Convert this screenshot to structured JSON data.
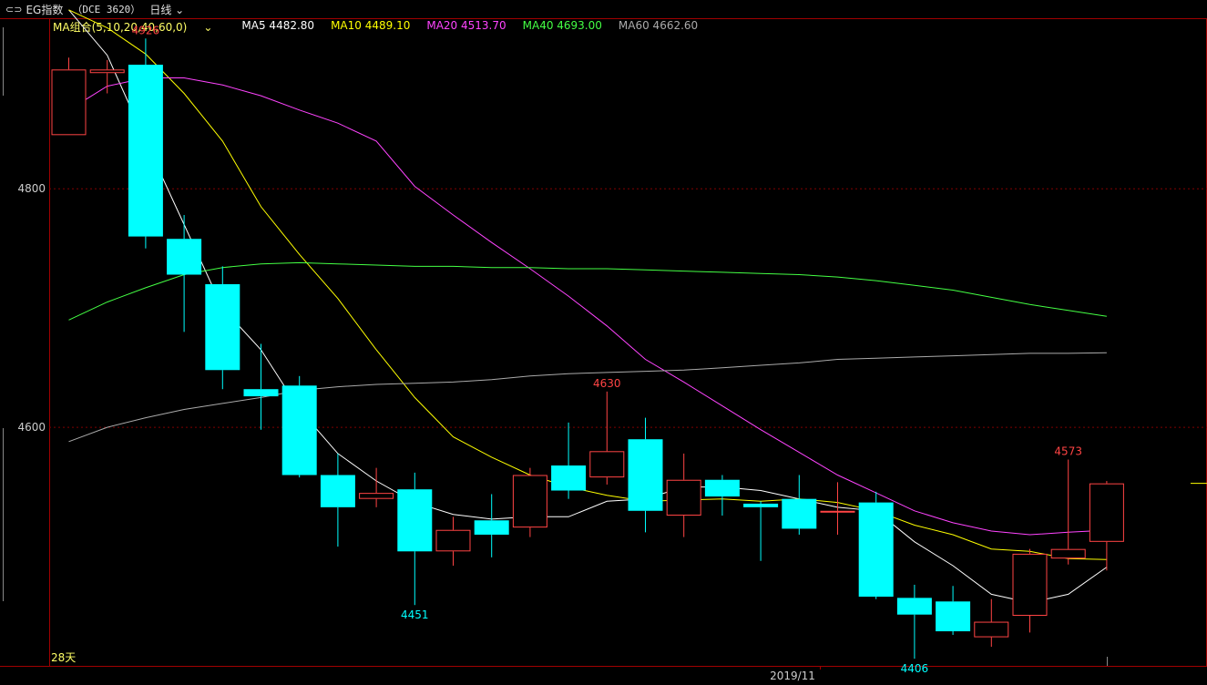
{
  "header": {
    "symbol": "EG指数",
    "code": "（DCE 3620）",
    "period": "日线",
    "period_arrow_icon": "chevron-down-icon"
  },
  "legend": {
    "group_label": "MA组合(5,10,20,40,60,0)",
    "items": [
      {
        "label": "MA5 4482.80",
        "color": "#ffffff"
      },
      {
        "label": "MA10 4489.10",
        "color": "#ffff00"
      },
      {
        "label": "MA20 4513.70",
        "color": "#ff44ff"
      },
      {
        "label": "MA40 4693.00",
        "color": "#44ff44"
      },
      {
        "label": "MA60 4662.60",
        "color": "#aaaaaa"
      }
    ]
  },
  "chart_data": {
    "type": "candlestick",
    "y_ticks": [
      4600,
      4800
    ],
    "ylim": [
      4400,
      4943
    ],
    "x_label": "2019/11",
    "days_label": "28天",
    "colors": {
      "up": "#ff4444",
      "down": "#00ffff",
      "grid": "#800000",
      "axis": "#a00000"
    },
    "candles": [
      {
        "o": 4845,
        "h": 4910,
        "l": 4845,
        "c": 4900
      },
      {
        "o": 4897,
        "h": 4908,
        "l": 4880,
        "c": 4900
      },
      {
        "o": 4904,
        "h": 4926,
        "l": 4750,
        "c": 4760
      },
      {
        "o": 4758,
        "h": 4778,
        "l": 4680,
        "c": 4728
      },
      {
        "o": 4720,
        "h": 4735,
        "l": 4632,
        "c": 4648
      },
      {
        "o": 4632,
        "h": 4670,
        "l": 4598,
        "c": 4626
      },
      {
        "o": 4635,
        "h": 4643,
        "l": 4558,
        "c": 4560
      },
      {
        "o": 4560,
        "h": 4578,
        "l": 4500,
        "c": 4533
      },
      {
        "o": 4540,
        "h": 4566,
        "l": 4533,
        "c": 4545
      },
      {
        "o": 4548,
        "h": 4562,
        "l": 4451,
        "c": 4496
      },
      {
        "o": 4496,
        "h": 4525,
        "l": 4484,
        "c": 4514
      },
      {
        "o": 4522,
        "h": 4544,
        "l": 4491,
        "c": 4510
      },
      {
        "o": 4516,
        "h": 4566,
        "l": 4508,
        "c": 4560
      },
      {
        "o": 4568,
        "h": 4604,
        "l": 4540,
        "c": 4547
      },
      {
        "o": 4558,
        "h": 4630,
        "l": 4552,
        "c": 4580
      },
      {
        "o": 4590,
        "h": 4608,
        "l": 4512,
        "c": 4530
      },
      {
        "o": 4526,
        "h": 4578,
        "l": 4508,
        "c": 4556
      },
      {
        "o": 4556,
        "h": 4560,
        "l": 4526,
        "c": 4542
      },
      {
        "o": 4536,
        "h": 4538,
        "l": 4488,
        "c": 4533
      },
      {
        "o": 4540,
        "h": 4560,
        "l": 4510,
        "c": 4515
      },
      {
        "o": 4530,
        "h": 4554,
        "l": 4510,
        "c": 4530
      },
      {
        "o": 4537,
        "h": 4546,
        "l": 4456,
        "c": 4458
      },
      {
        "o": 4457,
        "h": 4468,
        "l": 4406,
        "c": 4443
      },
      {
        "o": 4454,
        "h": 4467,
        "l": 4426,
        "c": 4429
      },
      {
        "o": 4424,
        "h": 4456,
        "l": 4416,
        "c": 4437
      },
      {
        "o": 4442,
        "h": 4498,
        "l": 4428,
        "c": 4494
      },
      {
        "o": 4490,
        "h": 4573,
        "l": 4485,
        "c": 4498
      },
      {
        "o": 4504,
        "h": 4555,
        "l": 4480,
        "c": 4553
      }
    ],
    "labels": [
      {
        "candle": 2,
        "value": 4926,
        "pos": "above",
        "text": "4926"
      },
      {
        "candle": 9,
        "value": 4451,
        "pos": "below",
        "text": "4451"
      },
      {
        "candle": 14,
        "value": 4630,
        "pos": "above",
        "text": "4630"
      },
      {
        "candle": 22,
        "value": 4406,
        "pos": "below",
        "text": "4406"
      },
      {
        "candle": 26,
        "value": 4573,
        "pos": "above",
        "text": "4573"
      }
    ],
    "series": [
      {
        "name": "MA5",
        "color": "#ffffff",
        "values": [
          4950,
          4912,
          4840,
          4770,
          4700,
          4665,
          4615,
          4578,
          4555,
          4537,
          4527,
          4523,
          4525,
          4525,
          4538,
          4540,
          4550,
          4550,
          4547,
          4540,
          4533,
          4530,
          4504,
          4484,
          4460,
          4453,
          4460,
          4482.8
        ]
      },
      {
        "name": "MA10",
        "color": "#ffff00",
        "values": [
          4950,
          4935,
          4913,
          4880,
          4840,
          4785,
          4745,
          4708,
          4665,
          4625,
          4592,
          4575,
          4560,
          4550,
          4543,
          4538,
          4539,
          4540,
          4538,
          4540,
          4537,
          4530,
          4518,
          4510,
          4498,
          4496,
          4490,
          4489.1
        ]
      },
      {
        "name": "MA20",
        "color": "#ff44ff",
        "values": [
          4866,
          4886,
          4893,
          4893,
          4887,
          4878,
          4866,
          4855,
          4840,
          4802,
          4778,
          4755,
          4733,
          4710,
          4685,
          4657,
          4638,
          4618,
          4598,
          4579,
          4560,
          4545,
          4530,
          4520,
          4513,
          4510,
          4512,
          4513.7
        ]
      },
      {
        "name": "MA40",
        "color": "#44ff44",
        "values": [
          4690,
          4705,
          4717,
          4728,
          4734,
          4737,
          4738,
          4737,
          4736,
          4735,
          4735,
          4734,
          4734,
          4733,
          4733,
          4732,
          4731,
          4730,
          4729,
          4728,
          4726,
          4723,
          4719,
          4715,
          4709,
          4703,
          4698,
          4693
        ]
      },
      {
        "name": "MA60",
        "color": "#aaaaaa",
        "values": [
          4588,
          4600,
          4608,
          4615,
          4620,
          4625,
          4631,
          4634,
          4636,
          4637,
          4638,
          4640,
          4643,
          4645,
          4646,
          4647,
          4648,
          4650,
          4652,
          4654,
          4657,
          4658,
          4659,
          4660,
          4661,
          4662,
          4662,
          4662.6
        ]
      }
    ],
    "tail_dash_value": 4553
  }
}
